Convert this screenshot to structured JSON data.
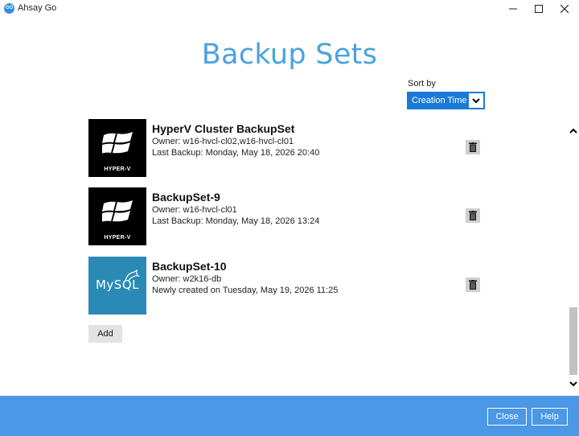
{
  "window": {
    "app_logo_text": "GO",
    "title": "Ahsay Go",
    "controls": [
      "minimize",
      "maximize",
      "close"
    ]
  },
  "page": {
    "title": "Backup Sets"
  },
  "sort": {
    "label": "Sort by",
    "value": "Creation Time"
  },
  "backup_sets": [
    {
      "name": "HyperV Cluster BackupSet",
      "owner": "Owner: w16-hvcl-cl02,w16-hvcl-cl01",
      "status": "Last Backup: Monday, May 18, 2026 20:40",
      "type": "hyperv",
      "tile_caption": "HYPER-V"
    },
    {
      "name": "BackupSet-9",
      "owner": "Owner: w16-hvcl-cl01",
      "status": "Last Backup: Monday, May 18, 2026 13:24",
      "type": "hyperv",
      "tile_caption": "HYPER-V"
    },
    {
      "name": "BackupSet-10",
      "owner": "Owner: w2k16-db",
      "status": "Newly created on Tuesday, May 19, 2026 11:25",
      "type": "mysql",
      "tile_caption": "MySQL"
    }
  ],
  "actions": {
    "add_label": "Add"
  },
  "footer": {
    "close_label": "Close",
    "help_label": "Help"
  },
  "colors": {
    "title_blue": "#4aa3dc",
    "sort_blue": "#1b7ad6",
    "footer_blue": "#4a98e6",
    "mysql_tile": "#2a8ab5",
    "hyperv_tile": "#000000"
  },
  "icons": [
    "app-logo-icon",
    "minimize-icon",
    "maximize-icon",
    "close-icon",
    "chevron-down-icon",
    "scroll-up-icon",
    "scroll-down-icon",
    "trash-icon",
    "windows-logo-icon",
    "mysql-dolphin-icon"
  ]
}
